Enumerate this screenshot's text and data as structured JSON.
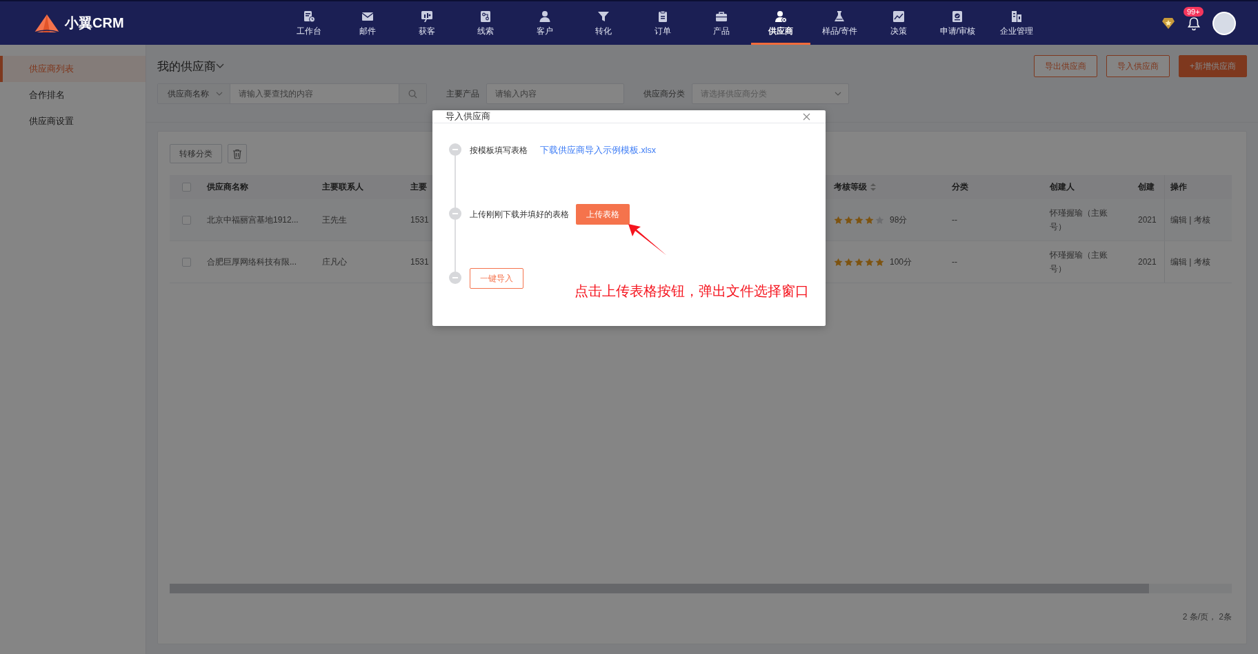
{
  "app": {
    "logo_text": "小翼CRM",
    "notification_badge": "99+"
  },
  "nav": [
    {
      "label": "工作台",
      "selected": false
    },
    {
      "label": "邮件",
      "selected": false
    },
    {
      "label": "获客",
      "selected": false
    },
    {
      "label": "线索",
      "selected": false
    },
    {
      "label": "客户",
      "selected": false
    },
    {
      "label": "转化",
      "selected": false
    },
    {
      "label": "订单",
      "selected": false
    },
    {
      "label": "产品",
      "selected": false
    },
    {
      "label": "供应商",
      "selected": true
    },
    {
      "label": "样品/寄件",
      "selected": false
    },
    {
      "label": "决策",
      "selected": false
    },
    {
      "label": "申请/审核",
      "selected": false
    },
    {
      "label": "企业管理",
      "selected": false
    }
  ],
  "sidebar": [
    {
      "label": "供应商列表",
      "selected": true
    },
    {
      "label": "合作排名",
      "selected": false
    },
    {
      "label": "供应商设置",
      "selected": false
    }
  ],
  "page": {
    "title": "我的供应商",
    "actions": [
      {
        "label": "导出供应商",
        "kind": "outline"
      },
      {
        "label": "导入供应商",
        "kind": "outline"
      },
      {
        "label": "+新增供应商",
        "kind": "primary"
      }
    ]
  },
  "filters": [
    {
      "kind": "search",
      "select": "供应商名称",
      "placeholder": "请输入要查找的内容"
    },
    {
      "kind": "input",
      "label": "主要产品",
      "placeholder": "请输入内容"
    },
    {
      "kind": "select",
      "label": "供应商分类",
      "placeholder": "请选择供应商分类"
    }
  ],
  "toolbar": {
    "move_button": "转移分类"
  },
  "table": {
    "select_all_checked": false,
    "columns": [
      {
        "label": "供应商名称",
        "sortable": false
      },
      {
        "label": "主要联系人",
        "sortable": false
      },
      {
        "label": "主要",
        "sortable": false
      },
      {
        "label": "考核等级",
        "sortable": true
      },
      {
        "label": "分类",
        "sortable": false
      },
      {
        "label": "创建人",
        "sortable": false
      },
      {
        "label": "创建",
        "sortable": false
      },
      {
        "label": "操作",
        "sortable": false
      }
    ],
    "rows": [
      {
        "checked": false,
        "name": "北京中福丽宫基地1912...",
        "contact": "王先生",
        "column_3": "1531",
        "stars": 4,
        "score": "98分",
        "category": "--",
        "creator": "怀瑾握瑜（主账号）",
        "created": "2021",
        "actions": "编辑 | 考核"
      },
      {
        "checked": false,
        "name": "合肥巨厚网络科技有限...",
        "contact": "庄凡心",
        "column_3": "1531",
        "stars": 5,
        "score": "100分",
        "category": "--",
        "creator": "怀瑾握瑜（主账号）",
        "created": "2021",
        "actions": "编辑 | 考核"
      }
    ],
    "pagination": "2 条/页， 2条"
  },
  "modal": {
    "title": "导入供应商",
    "steps": [
      {
        "kind": "link",
        "text": "按模板填写表格",
        "link": "下载供应商导入示例模板.xlsx"
      },
      {
        "kind": "upload",
        "text": "上传刚刚下载并填好的表格",
        "button": "上传表格"
      },
      {
        "kind": "import",
        "button": "一键导入"
      }
    ]
  },
  "annotation": {
    "text": "点击上传表格按钮，弹出文件选择窗口"
  }
}
